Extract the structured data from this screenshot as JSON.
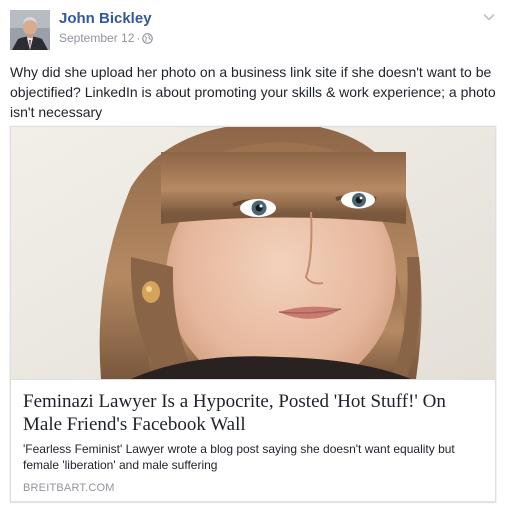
{
  "post": {
    "author": "John Bickley",
    "date": "September 12",
    "separator": "·",
    "privacy_icon": "globe-icon",
    "menu_icon": "chevron-down-icon",
    "text": "Why did she upload her photo on a business link site if she doesn't want to be objectified? LinkedIn is about promoting your skills & work experience; a photo isn't necessary"
  },
  "share": {
    "title": "Feminazi Lawyer Is a Hypocrite, Posted 'Hot Stuff!' On Male Friend's Facebook Wall",
    "description": "'Fearless Feminist' Lawyer wrote a blog post saying she doesn't want equality but female 'liberation' and male suffering",
    "domain": "BREITBART.COM"
  },
  "colors": {
    "author_link": "#365899",
    "meta_text": "#90949c",
    "body_text": "#1d2129",
    "card_border": "#dddfe2"
  }
}
